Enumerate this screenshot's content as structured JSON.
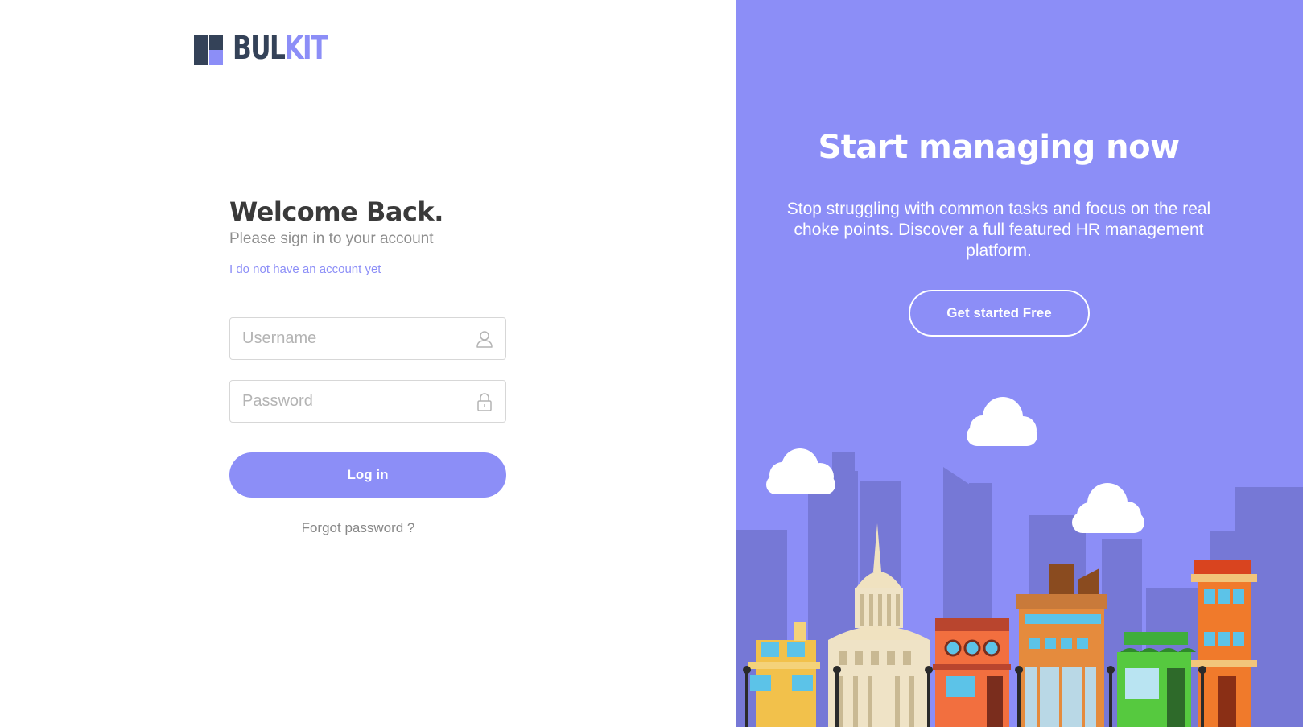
{
  "brand": {
    "name_part1": "BUL",
    "name_part2": "KIT",
    "color_dark": "#344258",
    "color_accent": "#8c8ef7"
  },
  "login": {
    "heading": "Welcome Back.",
    "subtitle": "Please sign in to your account",
    "signup_link": "I do not have an account yet",
    "username_placeholder": "Username",
    "password_placeholder": "Password",
    "username_icon": "user-icon",
    "password_icon": "lock-icon",
    "login_label": "Log in",
    "forgot_label": "Forgot password ?"
  },
  "promo": {
    "title": "Start managing now",
    "text": "Stop struggling with common tasks and focus on the real choke points. Discover a full featured HR management platform.",
    "cta_label": "Get started Free",
    "background": "#8c8ef7"
  }
}
